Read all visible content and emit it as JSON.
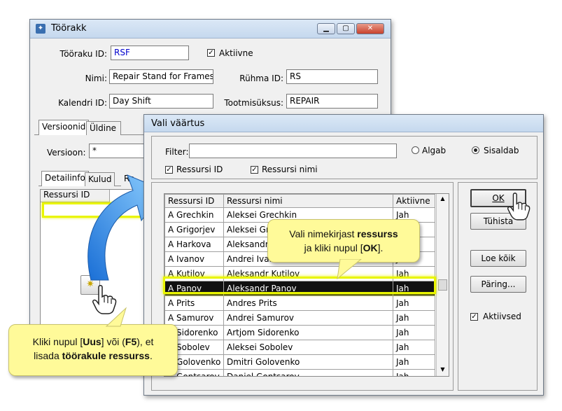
{
  "main_window": {
    "title": "Töörakk",
    "fields": {
      "toorak_id_label": "Tööraku ID:",
      "toorak_id_value": "RSF",
      "aktiivne_label": "Aktiivne",
      "nimi_label": "Nimi:",
      "nimi_value": "Repair Stand for Frames",
      "ruhma_id_label": "Rühma ID:",
      "ruhma_id_value": "RS",
      "kalendri_id_label": "Kalendri ID:",
      "kalendri_id_value": "Day Shift",
      "tootmisuksus_label": "Tootmisüksus:",
      "tootmisuksus_value": "REPAIR"
    },
    "tabs": [
      "Versioonid",
      "Üldine"
    ],
    "versioon_label": "Versioon:",
    "versioon_value": "*",
    "subtabs": [
      "Detailinfo",
      "Kulud",
      "Re"
    ],
    "subgrid_header": "Ressursi ID"
  },
  "dialog": {
    "title": "Vali väärtus",
    "filter_label": "Filter:",
    "filter_value": "",
    "radio_algab": "Algab",
    "radio_sisaldab": "Sisaldab",
    "chk_ressursi_id": "Ressursi ID",
    "chk_ressursi_nimi": "Ressursi nimi",
    "columns": [
      "Ressursi ID",
      "Ressursi nimi",
      "Aktiivne"
    ],
    "rows": [
      [
        "A Grechkin",
        "Aleksei Grechkin",
        "Jah"
      ],
      [
        "A Grigorjev",
        "Aleksei Gri",
        "Jah"
      ],
      [
        "A Harkova",
        "Aleksandra",
        "Jah"
      ],
      [
        "A Ivanov",
        "Andrei Ivan",
        "Jah"
      ],
      [
        "A Kutilov",
        "Aleksandr Kutilov",
        "Jah"
      ],
      [
        "A Panov",
        "Aleksandr Panov",
        "Jah"
      ],
      [
        "A Prits",
        "Andres Prits",
        "Jah"
      ],
      [
        "A Samurov",
        "Andrei Samurov",
        "Jah"
      ],
      [
        "A Sidorenko",
        "Artjom Sidorenko",
        "Jah"
      ],
      [
        "A Sobolev",
        "Aleksei Sobolev",
        "Jah"
      ],
      [
        "A Golovenko",
        "Dmitri Golovenko",
        "Jah"
      ],
      [
        "A Gontsarov",
        "Daniel Gontsarov",
        "Jah"
      ]
    ],
    "buttons": {
      "ok": "OK",
      "tuhista": "Tühista",
      "loe_koik": "Loe kõik",
      "paring": "Päring..."
    },
    "chk_aktiivsed": "Aktiivsed"
  },
  "callouts": {
    "left_html": "Kliki nupul [<b>Uus</b>] või (<b>F5</b>), et<br>lisada  <b>töörakule ressurss</b>.",
    "right_html": "Vali nimekirjast <b>ressurss</b><br>ja kliki nupul [<b>OK</b>]."
  },
  "colors": {
    "accent_text": "#0000cc",
    "highlight": "#e9f500",
    "callout_bg": "#fffa99"
  }
}
